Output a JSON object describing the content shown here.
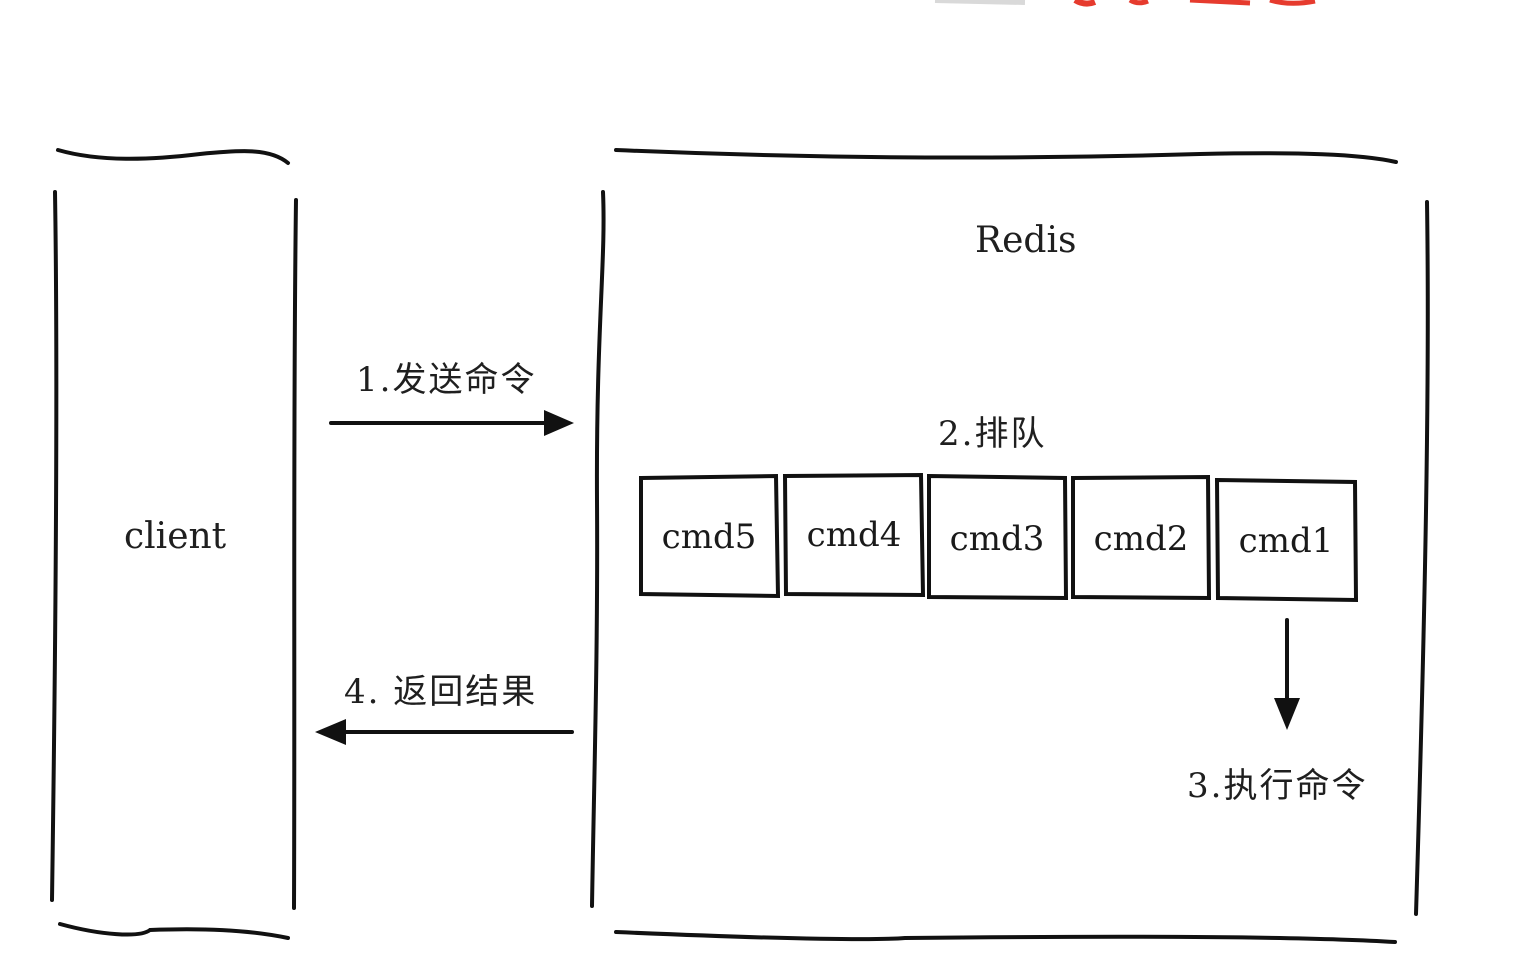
{
  "client": {
    "label": "client"
  },
  "redis": {
    "label": "Redis"
  },
  "steps": {
    "send": "1.发送命令",
    "queue": "2.排队",
    "execute": "3.执行命令",
    "return": "4. 返回结果"
  },
  "queue": [
    "cmd5",
    "cmd4",
    "cmd3",
    "cmd2",
    "cmd1"
  ],
  "colors": {
    "ink": "#111111",
    "background": "#ffffff",
    "header_fragment": "#e63b2e"
  }
}
